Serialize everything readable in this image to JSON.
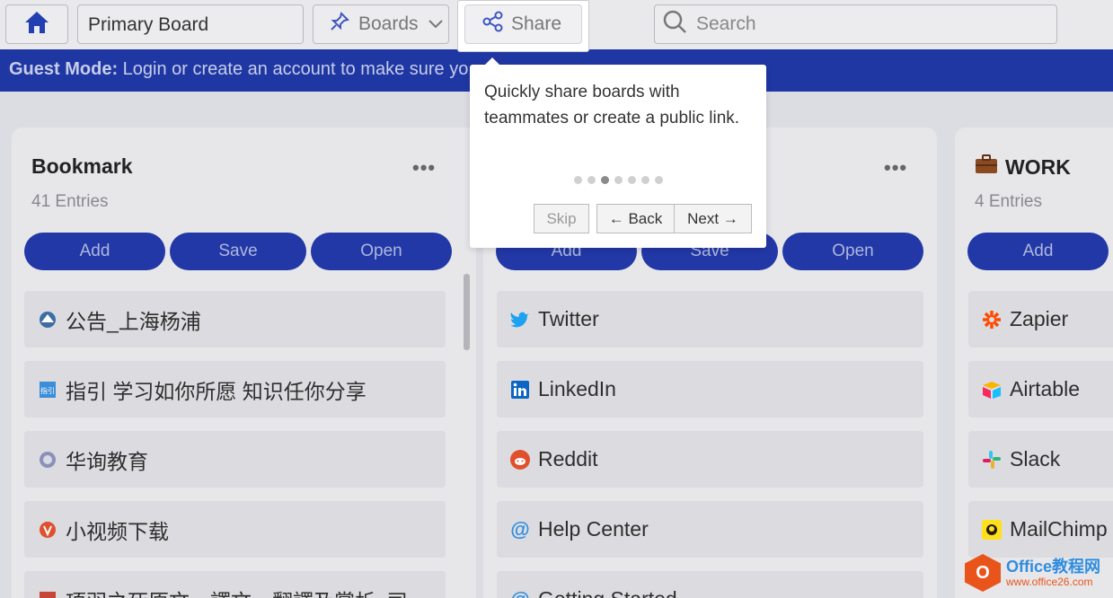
{
  "topbar": {
    "board_name": "Primary Board",
    "boards_label": "Boards",
    "share_label": "Share",
    "search_placeholder": "Search"
  },
  "banner": {
    "bold": "Guest Mode:",
    "text": " Login or create an account to make sure yo"
  },
  "columns": [
    {
      "title": "Bookmark",
      "count": "41 Entries",
      "buttons": [
        "Add",
        "Save",
        "Open"
      ],
      "entries": [
        {
          "icon": "site-logo-icon",
          "label": "公告_上海杨浦"
        },
        {
          "icon": "zhiyin-logo-icon",
          "label": "指引 学习如你所愿 知识任你分享"
        },
        {
          "icon": "globe-icon",
          "label": "华询教育"
        },
        {
          "icon": "video-logo-icon",
          "label": "小视频下载"
        },
        {
          "icon": "book-logo-icon",
          "label": "项羽之死原文、譯文、翻譯及賞析_司"
        }
      ]
    },
    {
      "title": "",
      "count": "",
      "buttons": [
        "Add",
        "Save",
        "Open"
      ],
      "entries": [
        {
          "icon": "twitter-icon",
          "label": "Twitter"
        },
        {
          "icon": "linkedin-icon",
          "label": "LinkedIn"
        },
        {
          "icon": "reddit-icon",
          "label": "Reddit"
        },
        {
          "icon": "at-icon",
          "label": "Help Center"
        },
        {
          "icon": "at-icon",
          "label": "Getting Started"
        }
      ]
    },
    {
      "title": "WORK",
      "count": "4 Entries",
      "buttons": [
        "Add"
      ],
      "entries": [
        {
          "icon": "zapier-icon",
          "label": "Zapier"
        },
        {
          "icon": "airtable-icon",
          "label": "Airtable"
        },
        {
          "icon": "slack-icon",
          "label": "Slack"
        },
        {
          "icon": "mailchimp-icon",
          "label": "MailChimp"
        }
      ]
    }
  ],
  "tooltip": {
    "text": "Quickly share boards with teammates or create a public link.",
    "step": 3,
    "total_steps": 7,
    "skip": "Skip",
    "back": "← Back",
    "next": "Next →"
  },
  "watermark": {
    "title": "Office教程网",
    "url": "www.office26.com"
  },
  "colors": {
    "banner": "#1f37a3",
    "buttons": "#2238a6",
    "watermark_orange": "#e9541a"
  }
}
